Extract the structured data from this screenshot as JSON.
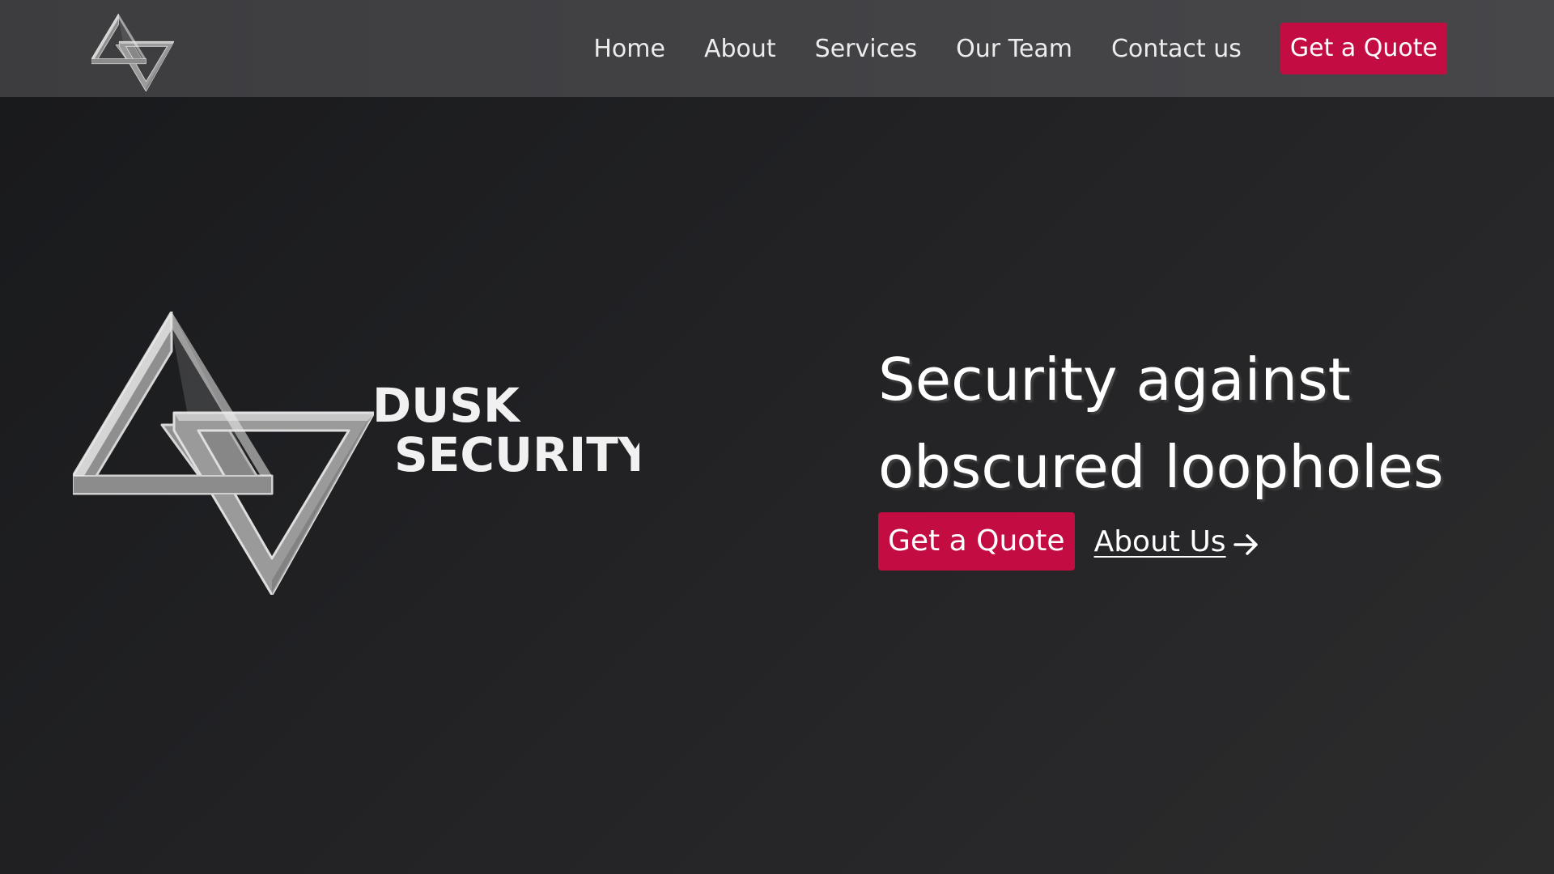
{
  "brand": {
    "name_line1": "DUSK",
    "name_line2": "SECURITY",
    "logo_icon": "interlocking-triangles-icon"
  },
  "nav": {
    "items": [
      {
        "label": "Home"
      },
      {
        "label": "About"
      },
      {
        "label": "Services"
      },
      {
        "label": "Our Team"
      },
      {
        "label": "Contact us"
      }
    ],
    "cta_label": "Get a Quote"
  },
  "hero": {
    "title_line1": "Security against",
    "title_line2": "obscured loopholes",
    "cta_label": "Get a Quote",
    "secondary_label": "About Us",
    "secondary_icon": "arrow-right-icon"
  },
  "colors": {
    "accent": "#c30c42",
    "navbar": "#444446",
    "background": "#222224",
    "text": "#ffffff"
  }
}
